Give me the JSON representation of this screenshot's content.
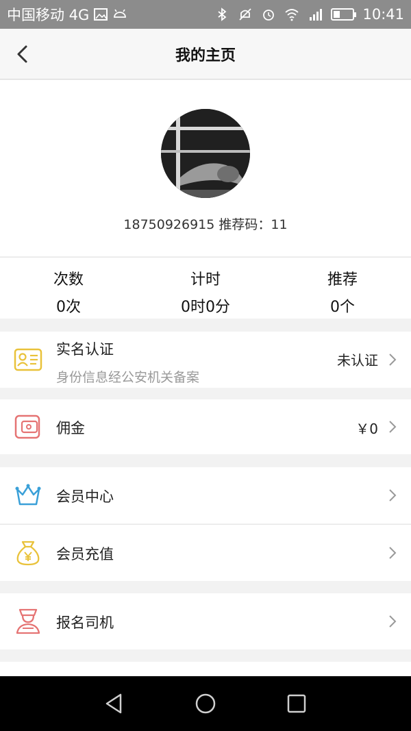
{
  "status_bar": {
    "carrier": "中国移动 4G",
    "time": "10:41",
    "battery_level": 0.35,
    "icons": [
      "gallery-icon",
      "android-icon",
      "bluetooth-icon",
      "mute-icon",
      "alarm-icon",
      "wifi-icon",
      "signal-icon",
      "battery-icon"
    ]
  },
  "navbar": {
    "title": "我的主页",
    "back_icon": "back-chevron-icon"
  },
  "profile": {
    "info": "18750926915 推荐码：11"
  },
  "stats": [
    {
      "label": "次数",
      "value": "0次"
    },
    {
      "label": "计时",
      "value": "0时0分"
    },
    {
      "label": "推荐",
      "value": "0个"
    }
  ],
  "rows": {
    "verify": {
      "title": "实名认证",
      "subtitle": "身份信息经公安机关备案",
      "value": "未认证",
      "icon": "id-card-icon"
    },
    "commission": {
      "title": "佣金",
      "value": "￥0",
      "icon": "wallet-icon"
    },
    "member_center": {
      "title": "会员中心",
      "icon": "crown-icon"
    },
    "member_recharge": {
      "title": "会员充值",
      "icon": "money-bag-icon"
    },
    "driver_signup": {
      "title": "报名司机",
      "icon": "driver-icon"
    }
  },
  "colors": {
    "status_bar": "#8c8c8c",
    "yellow_icon": "#e9c23a",
    "red_icon": "#e57373",
    "blue_icon": "#3aa0d8"
  }
}
